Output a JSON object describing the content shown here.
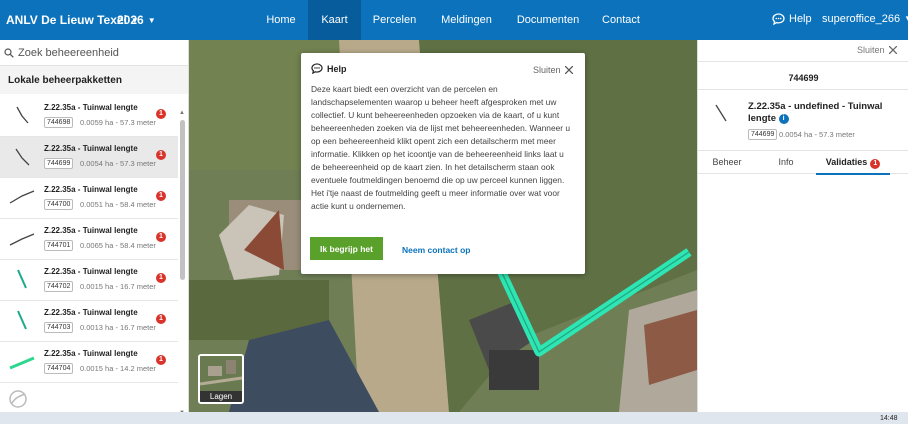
{
  "topbar": {
    "brand": "ANLV De Lieuw Texel",
    "year": "2026",
    "nav": [
      {
        "label": "Home",
        "active": false
      },
      {
        "label": "Kaart",
        "active": true
      },
      {
        "label": "Percelen",
        "active": false
      },
      {
        "label": "Meldingen",
        "active": false
      },
      {
        "label": "Documenten",
        "active": false
      },
      {
        "label": "Contact",
        "active": false
      }
    ],
    "help_label": "Help",
    "user": "superoffice_266",
    "color": "#0b72bb"
  },
  "sidebar": {
    "search_placeholder": "Zoek beheereenheid",
    "section_title": "Lokale beheerpakketten",
    "items": [
      {
        "title": "Z.22.35a - Tuinwal lengte",
        "id": "744698",
        "meta": "0.0059 ha - 57.3 meter",
        "badge": "1",
        "icon": "dark-line-icon"
      },
      {
        "title": "Z.22.35a - Tuinwal lengte",
        "id": "744699",
        "meta": "0.0054 ha - 57.3 meter",
        "badge": "1",
        "icon": "dark-line-icon"
      },
      {
        "title": "Z.22.35a - Tuinwal lengte",
        "id": "744700",
        "meta": "0.0051 ha - 58.4 meter",
        "badge": "1",
        "icon": "dark-line-icon"
      },
      {
        "title": "Z.22.35a - Tuinwal lengte",
        "id": "744701",
        "meta": "0.0065 ha - 58.4 meter",
        "badge": "1",
        "icon": "dark-line-icon"
      },
      {
        "title": "Z.22.35a - Tuinwal lengte",
        "id": "744702",
        "meta": "0.0015 ha - 16.7 meter",
        "badge": "1",
        "icon": "teal-line-icon"
      },
      {
        "title": "Z.22.35a - Tuinwal lengte",
        "id": "744703",
        "meta": "0.0013 ha - 16.7 meter",
        "badge": "1",
        "icon": "teal-line-icon"
      },
      {
        "title": "Z.22.35a - Tuinwal lengte",
        "id": "744704",
        "meta": "0.0015 ha - 14.2 meter",
        "badge": "1",
        "icon": "green-line-icon"
      }
    ],
    "selected_index": 1
  },
  "map": {
    "layers_label": "Lagen",
    "highlight_color": "#2ee6b3"
  },
  "help_modal": {
    "title": "Help",
    "close_label": "Sluiten",
    "body": "Deze kaart biedt een overzicht van de percelen en landschapselementen waarop u beheer heeft afgesproken met uw collectief. U kunt beheereenheden opzoeken via de kaart, of u kunt beheereenheden zoeken via de lijst met beheereenheden. Wanneer u op een beheereenheid klikt opent zich een detailscherm met meer informatie. Klikken op het icoontje van de beheereenheid links laat u de beheereenheid op de kaart zien. In het detailscherm staan ook eventuele foutmeldingen benoemd die op uw perceel kunnen liggen. Het i'tje naast de foutmelding geeft u meer informatie over wat voor actie kunt u ondernemen.",
    "primary_button": "Ik begrijp het",
    "secondary_link": "Neem contact op",
    "button_color": "#5aa12b"
  },
  "detail_panel": {
    "close_label": "Sluiten",
    "id": "744699",
    "title": "Z.22.35a - undefined - Tuinwal lengte",
    "tag": "744699",
    "meta": "0.0054 ha - 57.3 meter",
    "tabs": [
      {
        "label": "Beheer",
        "active": false
      },
      {
        "label": "Info",
        "active": false
      },
      {
        "label": "Validaties",
        "active": true,
        "badge": "1"
      }
    ]
  },
  "taskbar": {
    "clock": "14:48"
  }
}
